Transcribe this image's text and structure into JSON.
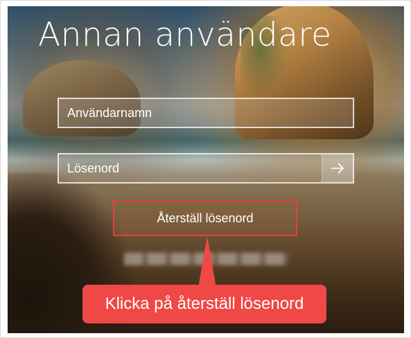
{
  "screen": {
    "title": "Annan användare"
  },
  "form": {
    "username_placeholder": "Användarnamn",
    "password_placeholder": "Lösenord",
    "submit_icon": "arrow-right-icon",
    "reset_password_label": "Återställ lösenord"
  },
  "annotation": {
    "callout_text": "Klicka på återställ lösenord",
    "highlight_color": "#e34040",
    "callout_color": "#f04747"
  }
}
